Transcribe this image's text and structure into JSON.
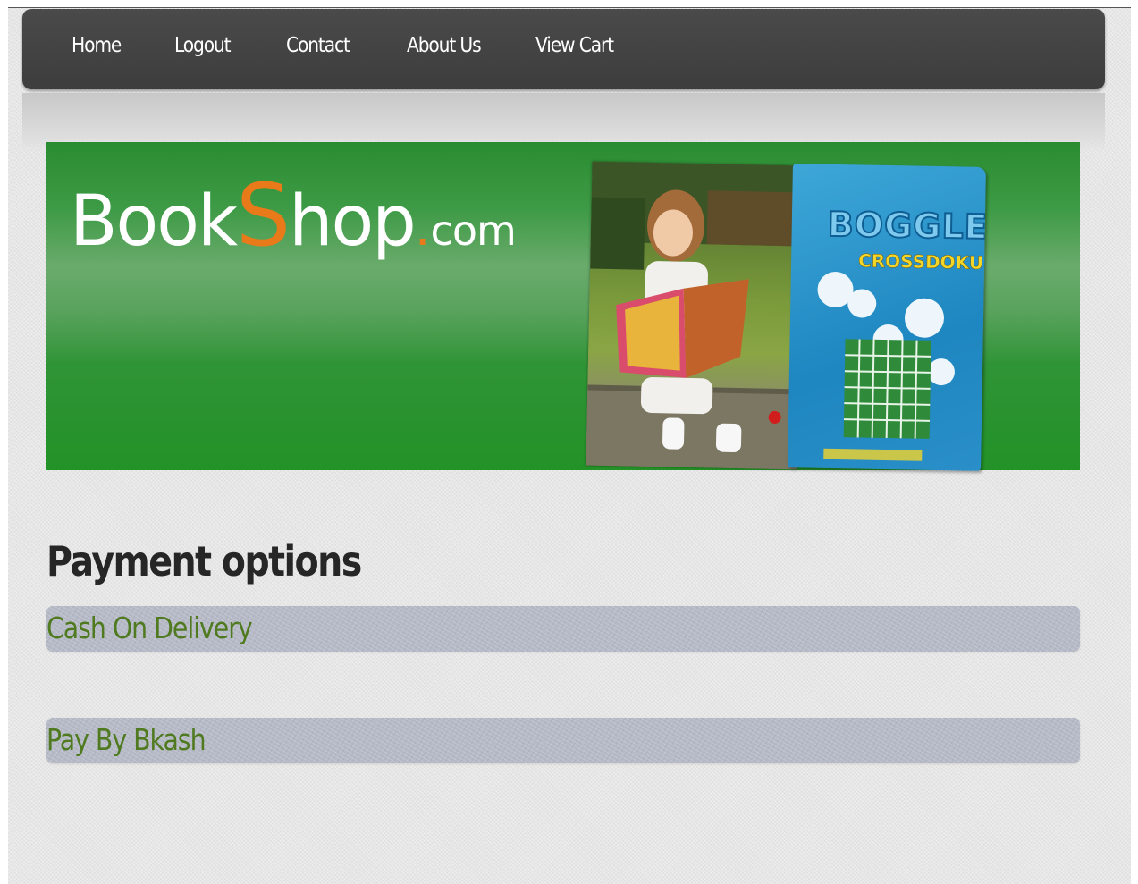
{
  "nav": {
    "items": [
      {
        "label": "Home"
      },
      {
        "label": "Logout"
      },
      {
        "label": "Contact"
      },
      {
        "label": "About Us"
      },
      {
        "label": "View Cart"
      }
    ]
  },
  "banner": {
    "logo_part1": "Book",
    "logo_accent": "S",
    "logo_part2": "hop",
    "logo_dot": ".",
    "logo_com": "com",
    "book_cover_title": "BOGGLE",
    "book_cover_subtitle": "CROSSDOKU",
    "colors": {
      "banner_green": "#2f9436",
      "logo_orange": "#e87a1a",
      "cover_blue": "#1e86c0"
    }
  },
  "main": {
    "title": "Payment options",
    "options": [
      {
        "label": "Cash On Delivery"
      },
      {
        "label": "Pay By Bkash"
      }
    ]
  },
  "colors": {
    "navbar": "#444444",
    "option_text": "#4f7a1f",
    "option_bg": "#b6bac7"
  }
}
